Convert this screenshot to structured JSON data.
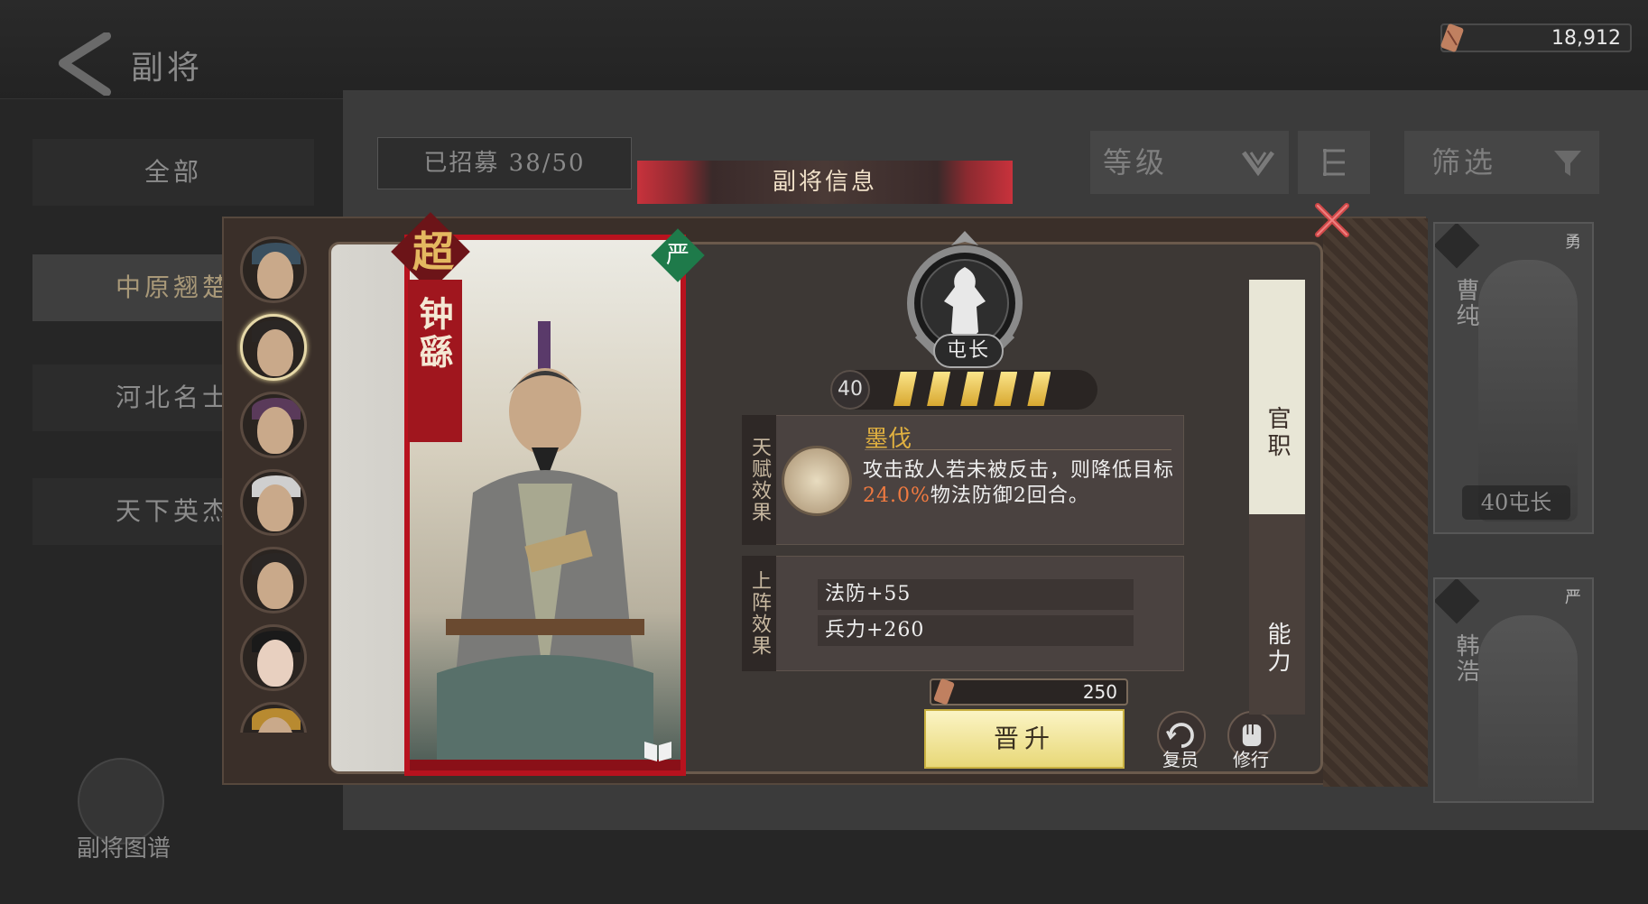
{
  "header": {
    "title": "副将"
  },
  "currency": {
    "amount": "18,912"
  },
  "categories": [
    "全部",
    "中原翘楚",
    "河北名士",
    "天下英杰"
  ],
  "recruit": {
    "label": "已招募 38/50"
  },
  "sort": {
    "label": "等级"
  },
  "filter": {
    "label": "筛选"
  },
  "bg_cards": [
    {
      "name": "曹纯",
      "level": "40屯长",
      "tag": "勇"
    },
    {
      "name": "韩浩",
      "level": "",
      "tag": "严"
    }
  ],
  "atlas": {
    "label": "副将图谱"
  },
  "modal": {
    "title": "副将信息",
    "general": {
      "rarity": "超",
      "name": "钟繇",
      "quality": "严"
    },
    "rank": {
      "title": "屯长",
      "level": "40",
      "stars": 5
    },
    "talent": {
      "side_label": "天赋效果",
      "name": "墨伐",
      "desc_before": "攻击敌人若未被反击，则降低目标",
      "desc_highlight": "24.0%",
      "desc_after": "物法防御2回合。"
    },
    "deploy": {
      "side_label": "上阵效果",
      "stats": [
        "法防+55",
        "兵力+260"
      ]
    },
    "cost": {
      "amount": "250"
    },
    "promote_label": "晋升",
    "restore_label": "复员",
    "train_label": "修行",
    "tabs": [
      "官职",
      "能力"
    ]
  },
  "colors": {
    "accent_red": "#b8121e",
    "gold": "#e0b040",
    "highlight": "#f07a40"
  }
}
